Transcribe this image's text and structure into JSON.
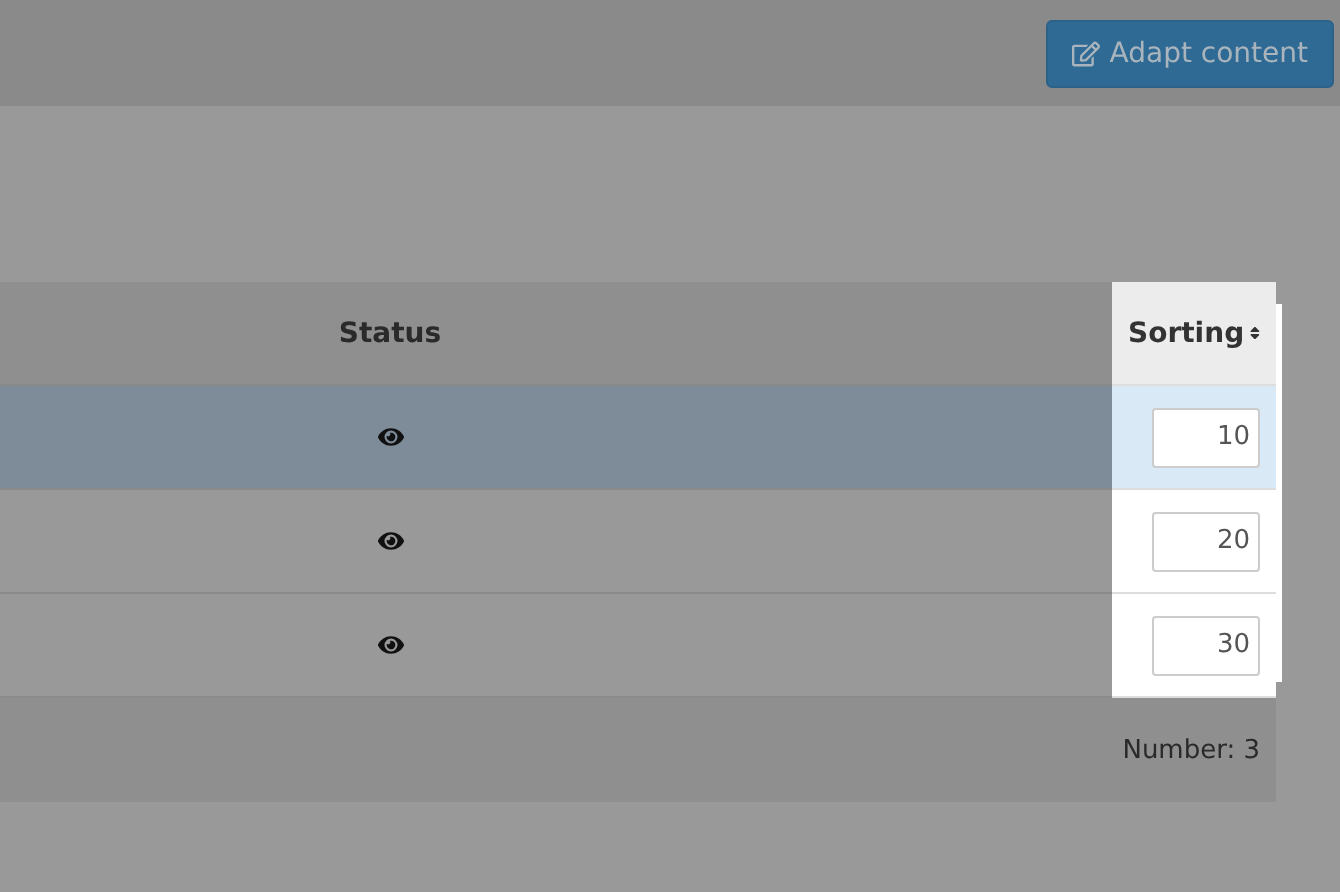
{
  "toolbar": {
    "button": "Adapt content"
  },
  "table": {
    "columns": [
      {
        "label": "Status",
        "sortable": false,
        "highlighted": false
      },
      {
        "label": "Sorting",
        "sortable": true,
        "highlighted": true
      }
    ],
    "rows": [
      {
        "selected": true,
        "sorting": "10"
      },
      {
        "selected": false,
        "sorting": "20"
      },
      {
        "selected": false,
        "sorting": "30"
      }
    ],
    "footer": "Number: 3"
  }
}
